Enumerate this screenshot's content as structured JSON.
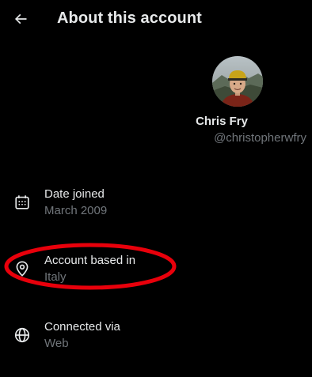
{
  "header": {
    "title": "About this account"
  },
  "profile": {
    "name": "Chris Fry",
    "handle": "@christopherwfry"
  },
  "details": [
    {
      "label": "Date joined",
      "value": "March 2009",
      "icon": "calendar-icon"
    },
    {
      "label": "Account based in",
      "value": "Italy",
      "icon": "location-pin-icon"
    },
    {
      "label": "Connected via",
      "value": "Web",
      "icon": "globe-icon"
    }
  ],
  "annotation": {
    "color": "#e8000b",
    "shape": "ellipse"
  },
  "colors": {
    "background": "#000000",
    "primary_text": "#e7e9ea",
    "secondary_text": "#71767b"
  }
}
